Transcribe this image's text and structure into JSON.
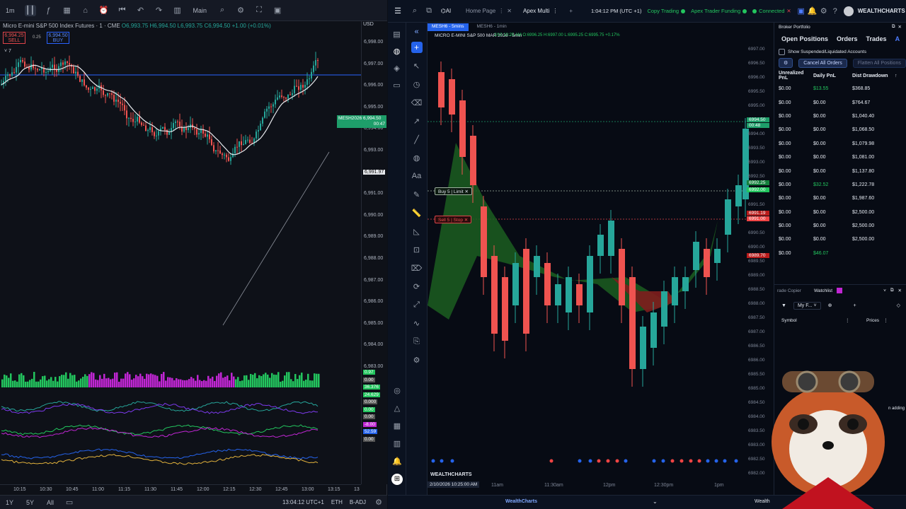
{
  "left": {
    "toolbar": {
      "interval": "1m",
      "layout": "Main"
    },
    "legend": {
      "symbol": "Micro E-mini S&P 500 Index Futures · 1 · CME",
      "ohlc": "O6,993.75 H6,994.50 L6,993.75 C6,994.50 +1.00 (+0.01%)",
      "sell_price": "6,994.25",
      "sell_label": "SELL",
      "spread": "0.25",
      "buy_price": "6,994.50",
      "buy_label": "BUY",
      "indicator_count": "7"
    },
    "currency": "USD",
    "price_ticks": [
      "6,998.00",
      "6,997.00",
      "6,996.00",
      "6,995.00",
      "6,994.00",
      "6,993.00",
      "6,992.00",
      "6,991.00",
      "6,990.00",
      "6,989.00",
      "6,988.00",
      "6,987.00",
      "6,986.00",
      "6,985.00",
      "6,984.00",
      "6,983.00"
    ],
    "last_price_label": "MESH2026",
    "last_price": "6,994.50",
    "last_countdown": "00:47",
    "crosshair_price": "6,991.97",
    "time_ticks": [
      "10:15",
      "10:30",
      "10:45",
      "11:00",
      "11:15",
      "11:30",
      "11:45",
      "12:00",
      "12:15",
      "12:30",
      "12:45",
      "13:00",
      "13:15",
      "13"
    ],
    "osc_labels": [
      "0.97",
      "0.00",
      "36.376",
      "24.629",
      "0.000",
      "0.00",
      "0.00",
      "-8.00",
      "52.59",
      "0.00"
    ],
    "bottom": {
      "ranges": [
        "1Y",
        "5Y",
        "All"
      ],
      "clock": "13:04:12 UTC+1",
      "session": "ETH",
      "adj": "B-ADJ"
    }
  },
  "right": {
    "tabs": [
      {
        "label": "Home Page"
      },
      {
        "label": "Apex Multi"
      }
    ],
    "clock": "1:04:12 PM (UTC +1)",
    "status": {
      "copy_trading": "Copy Trading",
      "apex": "Apex Trader Funding",
      "connected": "Connected"
    },
    "brand": "WEALTHCHARTS",
    "chart_tabs": [
      "MESH6 - 5mins",
      "MESH6 - 1min"
    ],
    "chart_title": "MICRO E-MINI S&P 500 MAR 2026 - 5min",
    "chart_ohlc": "2/10 10:25 AM O:6996.25 H:6997.00 L:6995.25 C:6995.75 +0.17%",
    "price_ticks": [
      "6997.00",
      "6996.50",
      "6996.00",
      "6995.50",
      "6995.00",
      "6994.50",
      "6994.00",
      "6993.50",
      "6993.00",
      "6992.50",
      "6992.00",
      "6991.50",
      "6991.00",
      "6990.50",
      "6990.00",
      "6989.50",
      "6989.00",
      "6988.50",
      "6988.00",
      "6987.50",
      "6987.00",
      "6986.50",
      "6986.00",
      "6985.50",
      "6985.00",
      "6984.50",
      "6984.00",
      "6983.50",
      "6983.00",
      "6982.50",
      "6982.00"
    ],
    "last_price": "6994.50",
    "last_countdown": "00:48",
    "buy_order": "Buy 5 | Limit",
    "buy_order_price": "6992.25",
    "buy_order_price2": "6992.00",
    "sell_order": "Sell 5 | Stop",
    "sell_order_price": "6991.19",
    "sell_order_price2": "6991.00",
    "other_price": "6989.70",
    "time_ticks": [
      "11am",
      "11:30am",
      "12pm",
      "12:30pm",
      "1pm"
    ],
    "footer_date": "2/10/2026 10:25:00 AM",
    "footer_brand": "WEALTHCHARTS",
    "footer_center": "WealthCharts",
    "footer_right": "Wealth",
    "portfolio": {
      "title": "Broker Portfolio",
      "tabs": [
        "Open Positions",
        "Orders",
        "Trades",
        "A"
      ],
      "checkbox_label": "Show Suspended/Liquidated Accounts",
      "cancel_label": "Cancel All Orders",
      "flatten_label": "Flatten All Positions",
      "headers": [
        "Unrealized PnL",
        "Daily PnL",
        "Dist Drawdown"
      ],
      "rows": [
        [
          "$0.00",
          "$13.55",
          "$368.85"
        ],
        [
          "$0.00",
          "$0.00",
          "$764.67"
        ],
        [
          "$0.00",
          "$0.00",
          "$1,040.40"
        ],
        [
          "$0.00",
          "$0.00",
          "$1,068.50"
        ],
        [
          "$0.00",
          "$0.00",
          "$1,079.98"
        ],
        [
          "$0.00",
          "$0.00",
          "$1,081.00"
        ],
        [
          "$0.00",
          "$0.00",
          "$1,137.80"
        ],
        [
          "$0.00",
          "$32.52",
          "$1,222.78"
        ],
        [
          "$0.00",
          "$0.00",
          "$1,987.60"
        ],
        [
          "$0.00",
          "$0.00",
          "$2,500.00"
        ],
        [
          "$0.00",
          "$0.00",
          "$2,500.00"
        ],
        [
          "$0.00",
          "$0.00",
          "$2,500.00"
        ]
      ],
      "totals": [
        "$0.00",
        "$46.07"
      ]
    },
    "watchlist": {
      "copier_tab": "rade Copier",
      "title": "Watchlist",
      "list_name": "My F...",
      "columns": [
        "Symbol",
        "Prices"
      ],
      "overlay_text": "n adding"
    }
  }
}
